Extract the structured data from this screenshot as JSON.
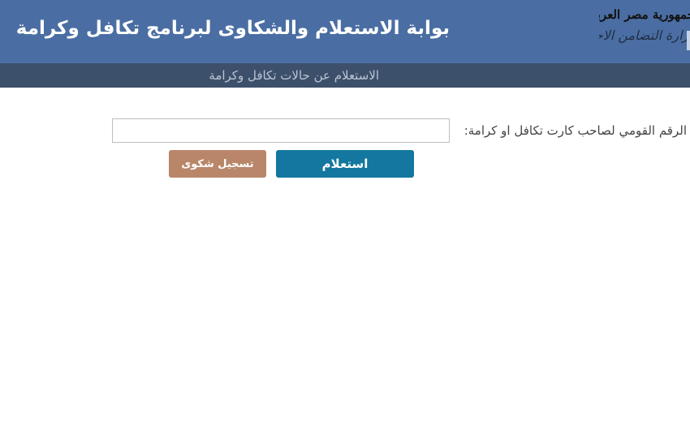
{
  "header": {
    "title": "بوابة الاستعلام والشكاوى لبرنامج تكافل وكرامة",
    "logo": {
      "line1": "جمهورية مصر العربية",
      "line2": "وزارة التضامن الاجتماعي"
    }
  },
  "subheader": {
    "link_label": "الاستعلام عن حالات تكافل وكرامة"
  },
  "form": {
    "label": "الرقم القومي لصاحب كارت تكافل او كرامة:",
    "input_value": "",
    "inquiry_button": "استعلام",
    "complaint_button": "تسجيل شكوى"
  },
  "colors": {
    "header_bg": "#4a6ea3",
    "subheader_bg": "#3d506b",
    "inquiry_button": "#13779f",
    "complaint_button": "#b9866a"
  }
}
